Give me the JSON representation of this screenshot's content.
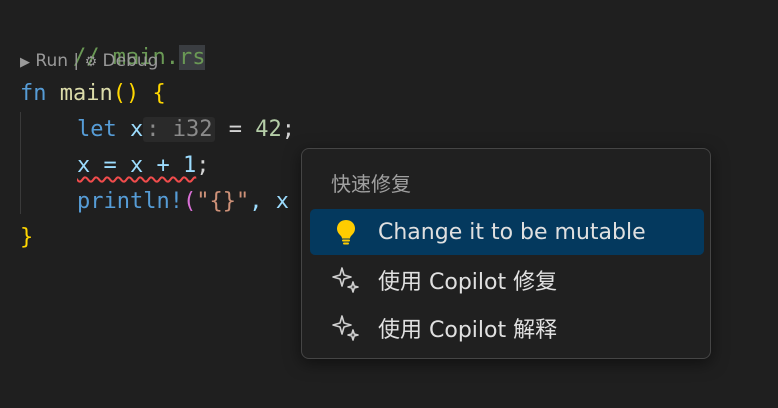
{
  "editor": {
    "comment_slashes": "// ",
    "comment_main": "main",
    "comment_dot": ".",
    "comment_ext": "rs",
    "codelens": {
      "run_icon": "▶",
      "run_label": "Run",
      "separator": "|",
      "debug_icon": "⚙",
      "debug_label": "Debug"
    },
    "line_fn": {
      "kw": "fn",
      "name": "main",
      "parens": "()",
      "brace": "{"
    },
    "line_let": {
      "kw": "let",
      "var": "x",
      "hint": ": i32",
      "eq": " = ",
      "num": "42",
      "semi": ";"
    },
    "line_assign": {
      "code": "x = x + 1",
      "semi": ";"
    },
    "line_print": {
      "macro": "println!",
      "open": "(",
      "str": "\"{}\"",
      "rest": ", x"
    },
    "close_brace": "}"
  },
  "quickfix": {
    "title": "快速修复",
    "items": [
      {
        "label": "Change it to be mutable",
        "icon": "lightbulb-icon",
        "selected": true
      },
      {
        "label": "使用 Copilot 修复",
        "icon": "sparkle-icon",
        "selected": false
      },
      {
        "label": "使用 Copilot 解释",
        "icon": "sparkle-icon",
        "selected": false
      }
    ]
  },
  "colors": {
    "background": "#1f1f1f",
    "selection": "#04395e",
    "lightbulb": "#ffcc00",
    "error_squiggle": "#f14c4c"
  }
}
